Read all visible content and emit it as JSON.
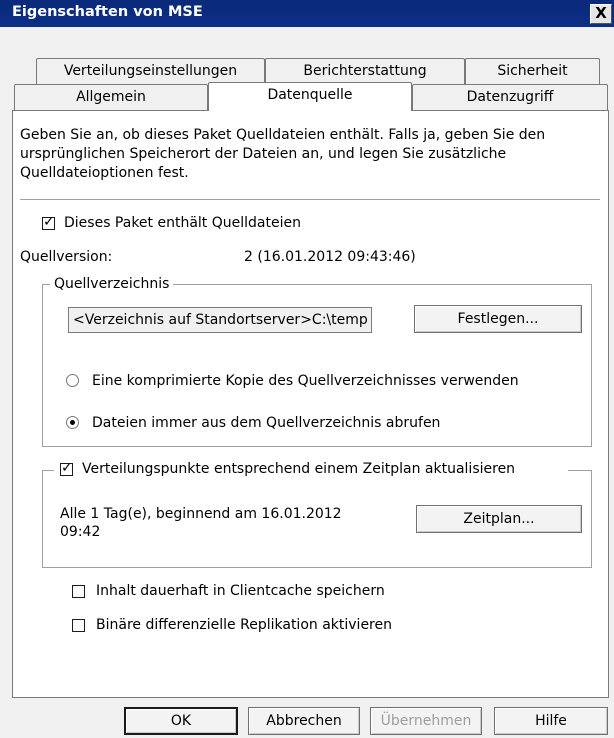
{
  "window": {
    "title": "Eigenschaften von MSE",
    "close_label": "X"
  },
  "tabs_row1": [
    "Verteilungseinstellungen",
    "Berichterstattung",
    "Sicherheit"
  ],
  "tabs_row2": [
    "Allgemein",
    "Datenquelle",
    "Datenzugriff"
  ],
  "active_tab": "Datenquelle",
  "intro": "Geben Sie an, ob dieses Paket Quelldateien enthält. Falls ja, geben Sie den ursprünglichen Speicherort der Dateien an, und legen Sie zusätzliche Quelldateioptionen fest.",
  "contains_source": {
    "label": "Dieses Paket enthält Quelldateien",
    "checked": true
  },
  "source_version": {
    "label": "Quellversion:",
    "value": "2 (16.01.2012 09:43:46)"
  },
  "source_dir": {
    "group_title": "Quellverzeichnis",
    "path_value": "<Verzeichnis auf Standortserver>C:\\temp",
    "set_button": "Festlegen...",
    "radio_compressed": {
      "label": "Eine komprimierte Kopie des Quellverzeichnisses verwenden",
      "selected": false
    },
    "radio_always": {
      "label": "Dateien immer aus dem Quellverzeichnis abrufen",
      "selected": true
    }
  },
  "schedule": {
    "checkbox_label": "Verteilungspunkte entsprechend einem Zeitplan aktualisieren",
    "checked": true,
    "description_line1": "Alle 1 Tag(e), beginnend am 16.01.2012",
    "description_line2": "09:42",
    "button": "Zeitplan..."
  },
  "persist_cache": {
    "label": "Inhalt dauerhaft in Clientcache speichern",
    "checked": false
  },
  "binary_replication": {
    "label": "Binäre differenzielle Replikation aktivieren",
    "checked": false
  },
  "buttons": {
    "ok": "OK",
    "cancel": "Abbrechen",
    "apply": "Übernehmen",
    "help": "Hilfe"
  }
}
